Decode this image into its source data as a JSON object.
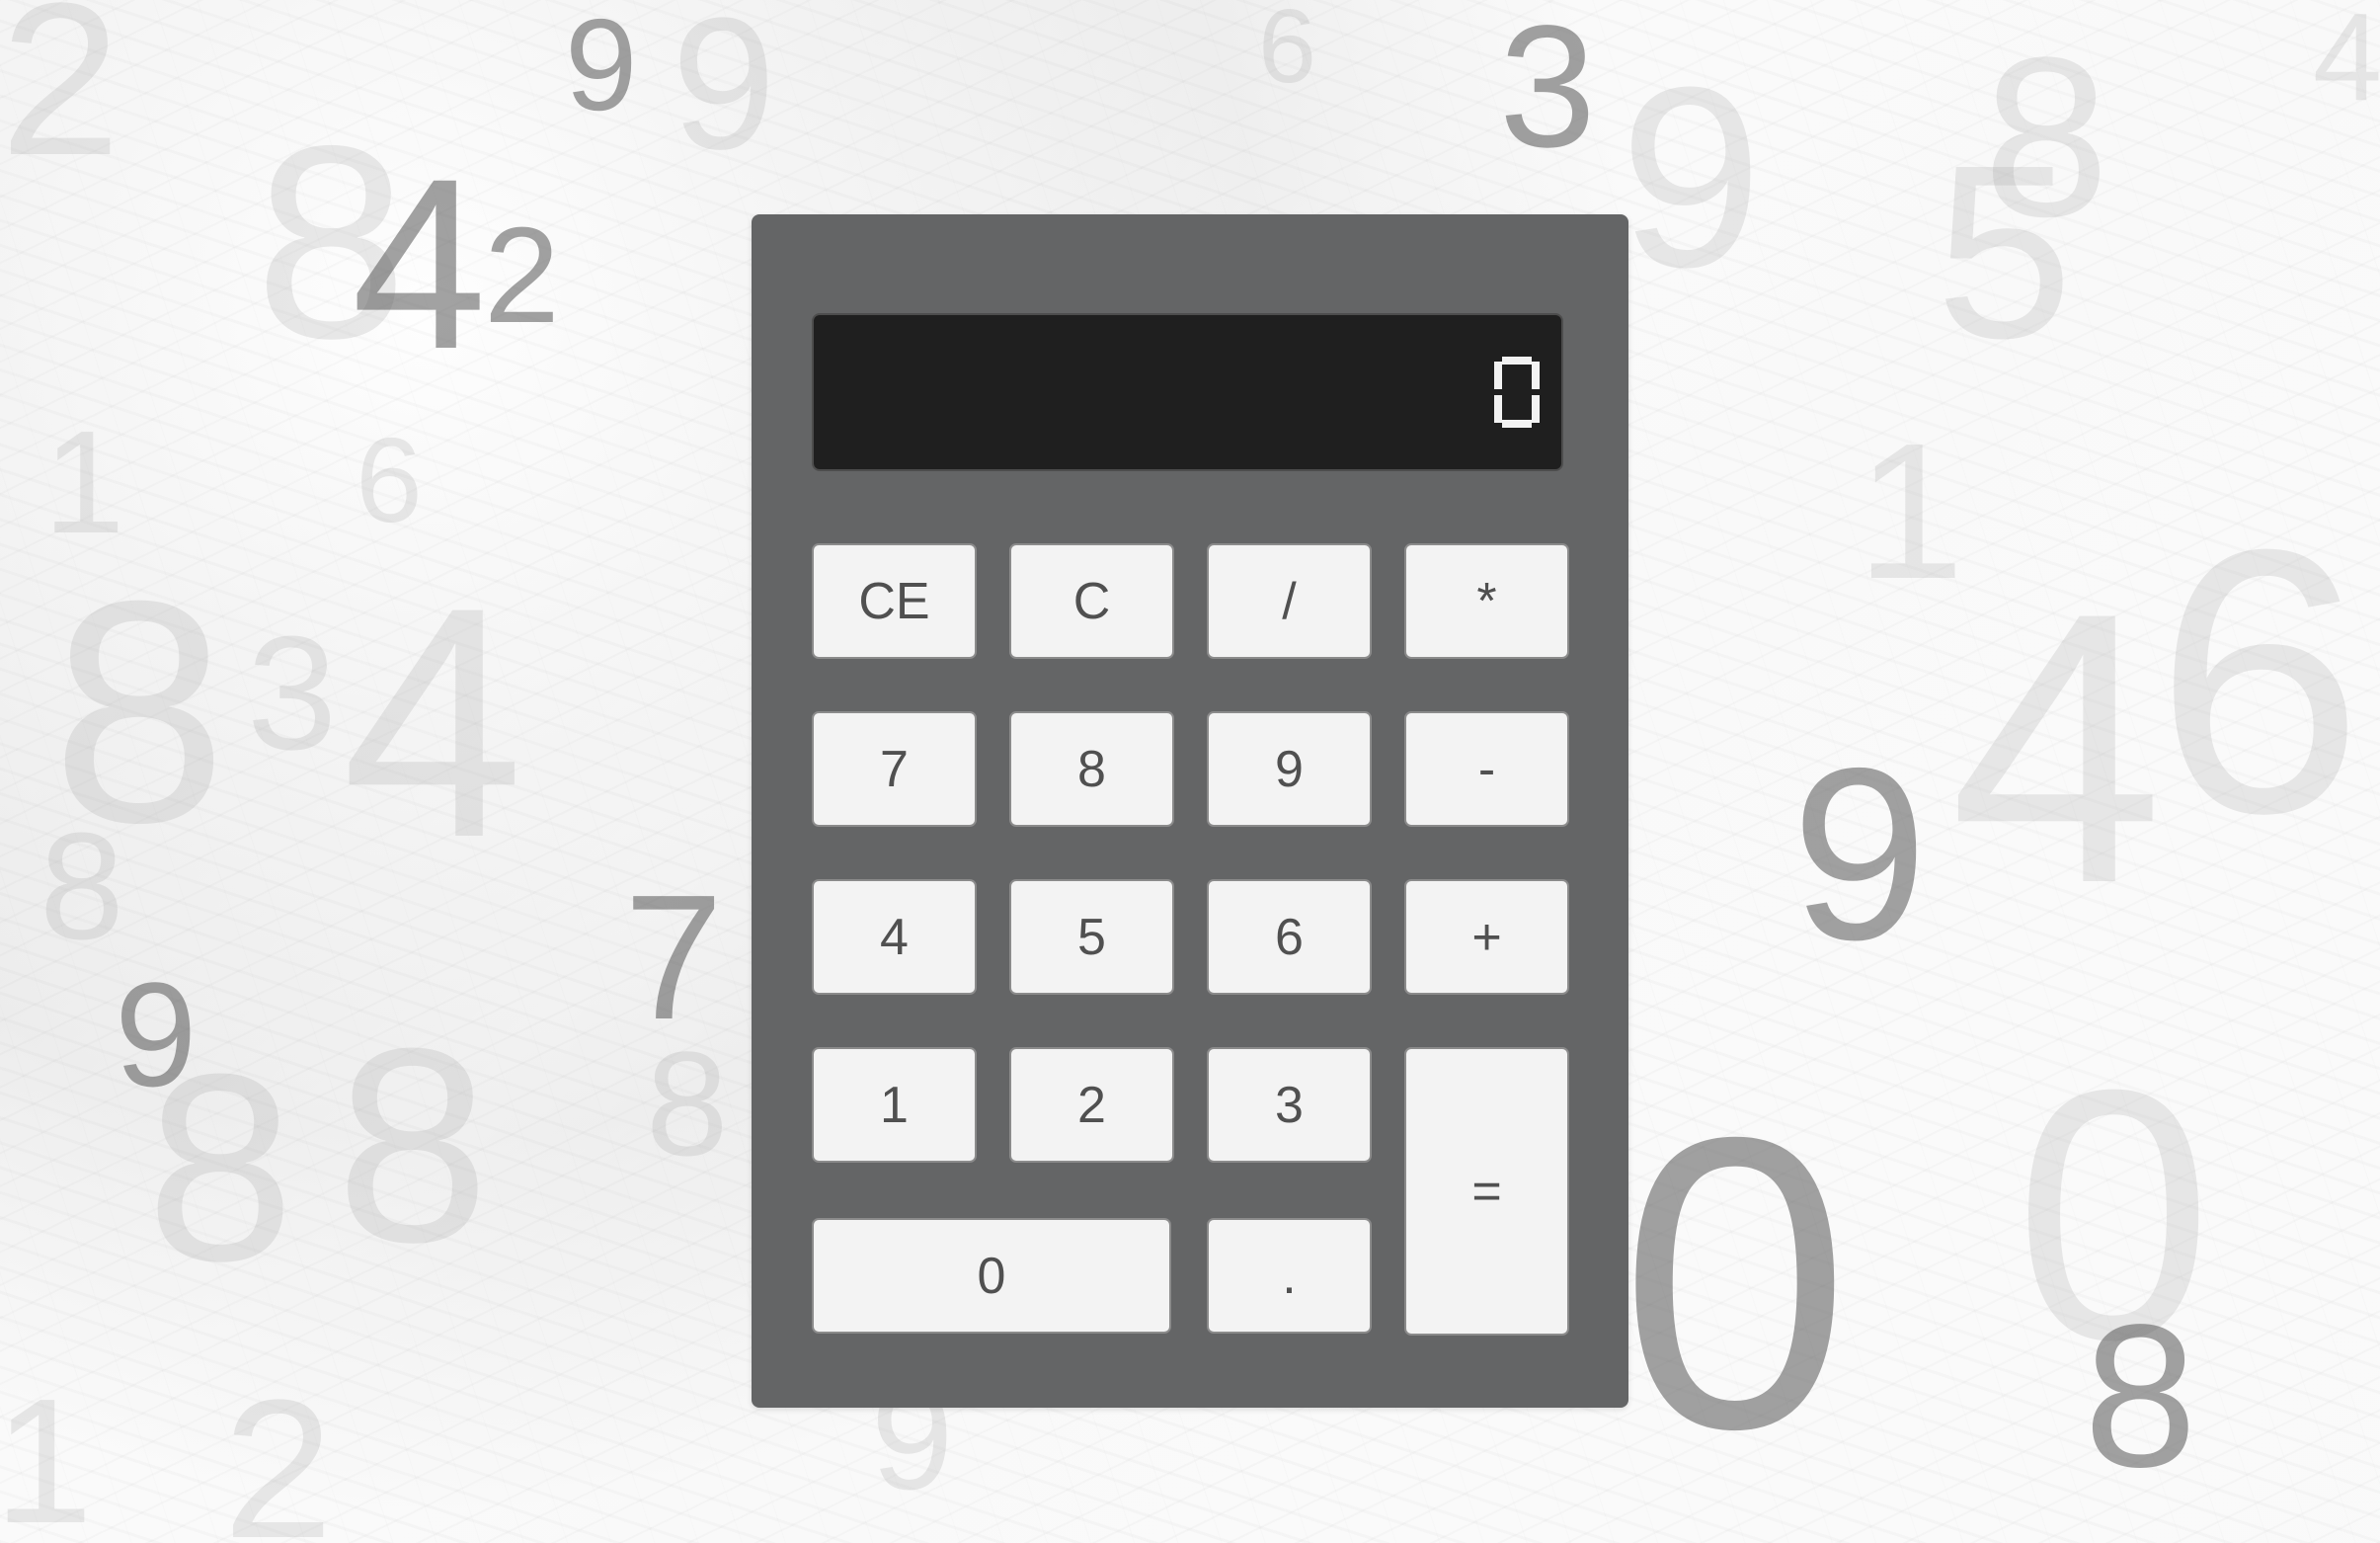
{
  "background_digits": [
    "2",
    "9",
    "9",
    "6",
    "3",
    "4",
    "9",
    "8",
    "5",
    "8",
    "4",
    "2",
    "1",
    "6",
    "8",
    "3",
    "4",
    "8",
    "1",
    "7",
    "9",
    "8",
    "4",
    "6",
    "9",
    "8",
    "8",
    "0",
    "9",
    "0",
    "8",
    "2",
    "1"
  ],
  "display": {
    "value": "0"
  },
  "keys": [
    {
      "label": "CE"
    },
    {
      "label": "C"
    },
    {
      "label": "/"
    },
    {
      "label": "*"
    },
    {
      "label": "7"
    },
    {
      "label": "8"
    },
    {
      "label": "9"
    },
    {
      "label": "-"
    },
    {
      "label": "4"
    },
    {
      "label": "5"
    },
    {
      "label": "6"
    },
    {
      "label": "+"
    },
    {
      "label": "1"
    },
    {
      "label": "2"
    },
    {
      "label": "3"
    },
    {
      "label": "="
    },
    {
      "label": "0"
    },
    {
      "label": "."
    }
  ],
  "colors": {
    "calculator_body": "#646566",
    "display_bg": "#1f1f1f",
    "key_bg": "#f3f3f3",
    "key_text": "#505050",
    "display_text": "#f2f2f2"
  }
}
